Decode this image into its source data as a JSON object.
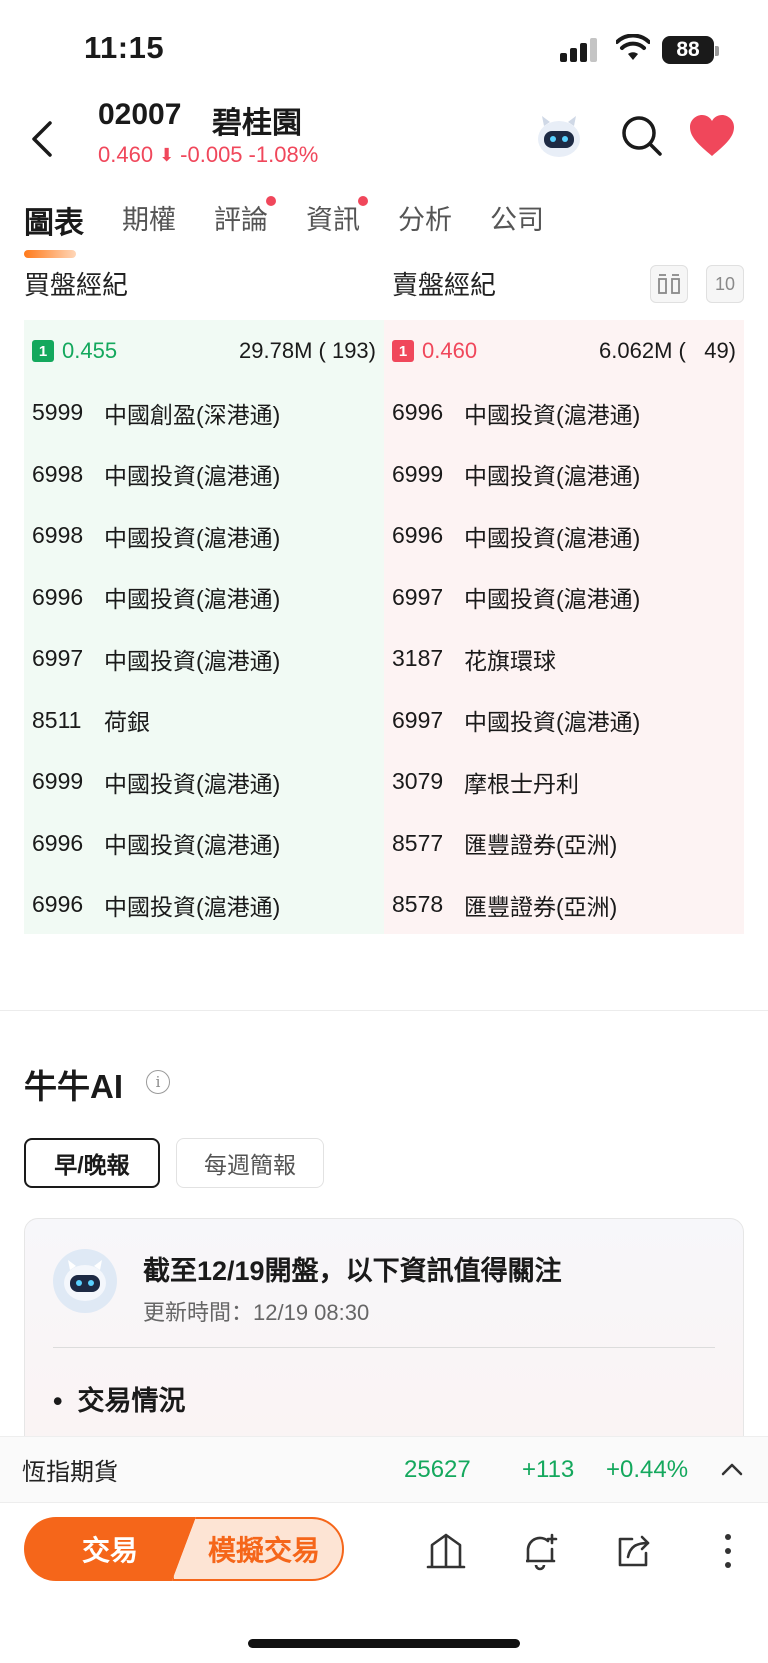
{
  "status": {
    "time": "11:15",
    "battery": "88"
  },
  "header": {
    "code": "02007",
    "name": "碧桂園",
    "price": "0.460",
    "change": "-0.005",
    "change_pct": "-1.08%"
  },
  "tabs": [
    {
      "label": "圖表",
      "active": true,
      "dot": false
    },
    {
      "label": "期權",
      "active": false,
      "dot": false
    },
    {
      "label": "評論",
      "active": false,
      "dot": true
    },
    {
      "label": "資訊",
      "active": false,
      "dot": true
    },
    {
      "label": "分析",
      "active": false,
      "dot": false
    },
    {
      "label": "公司",
      "active": false,
      "dot": false
    }
  ],
  "broker": {
    "bid_title": "買盤經紀",
    "ask_title": "賣盤經紀",
    "depth_label": "10",
    "bid_top": {
      "level": "1",
      "price": "0.455",
      "volume": "29.78M ( 193)"
    },
    "ask_top": {
      "level": "1",
      "price": "0.460",
      "volume": "6.062M (   49)"
    },
    "bids": [
      {
        "id": "5999",
        "name": "中國創盈(深港通)"
      },
      {
        "id": "6998",
        "name": "中國投資(滬港通)"
      },
      {
        "id": "6998",
        "name": "中國投資(滬港通)"
      },
      {
        "id": "6996",
        "name": "中國投資(滬港通)"
      },
      {
        "id": "6997",
        "name": "中國投資(滬港通)"
      },
      {
        "id": "8511",
        "name": "荷銀"
      },
      {
        "id": "6999",
        "name": "中國投資(滬港通)"
      },
      {
        "id": "6996",
        "name": "中國投資(滬港通)"
      },
      {
        "id": "6996",
        "name": "中國投資(滬港通)"
      }
    ],
    "asks": [
      {
        "id": "6996",
        "name": "中國投資(滬港通)"
      },
      {
        "id": "6999",
        "name": "中國投資(滬港通)"
      },
      {
        "id": "6996",
        "name": "中國投資(滬港通)"
      },
      {
        "id": "6997",
        "name": "中國投資(滬港通)"
      },
      {
        "id": "3187",
        "name": "花旗環球"
      },
      {
        "id": "6997",
        "name": "中國投資(滬港通)"
      },
      {
        "id": "3079",
        "name": "摩根士丹利"
      },
      {
        "id": "8577",
        "name": "匯豐證券(亞洲)"
      },
      {
        "id": "8578",
        "name": "匯豐證券(亞洲)"
      }
    ]
  },
  "ai": {
    "title": "牛牛AI",
    "chip_active": "早/晚報",
    "chip_inactive": "每週簡報",
    "headline": "截至12/19開盤，以下資訊值得關注",
    "updated": "更新時間：12/19 08:30",
    "bullet": "交易情況"
  },
  "futures": {
    "name": "恆指期貨",
    "value": "25627",
    "change": "+113",
    "change_pct": "+0.44%"
  },
  "bottom": {
    "trade": "交易",
    "sim_trade": "模擬交易"
  },
  "colors": {
    "up": "#14a85d",
    "down": "#f0475b",
    "accent": "#f5661a"
  }
}
